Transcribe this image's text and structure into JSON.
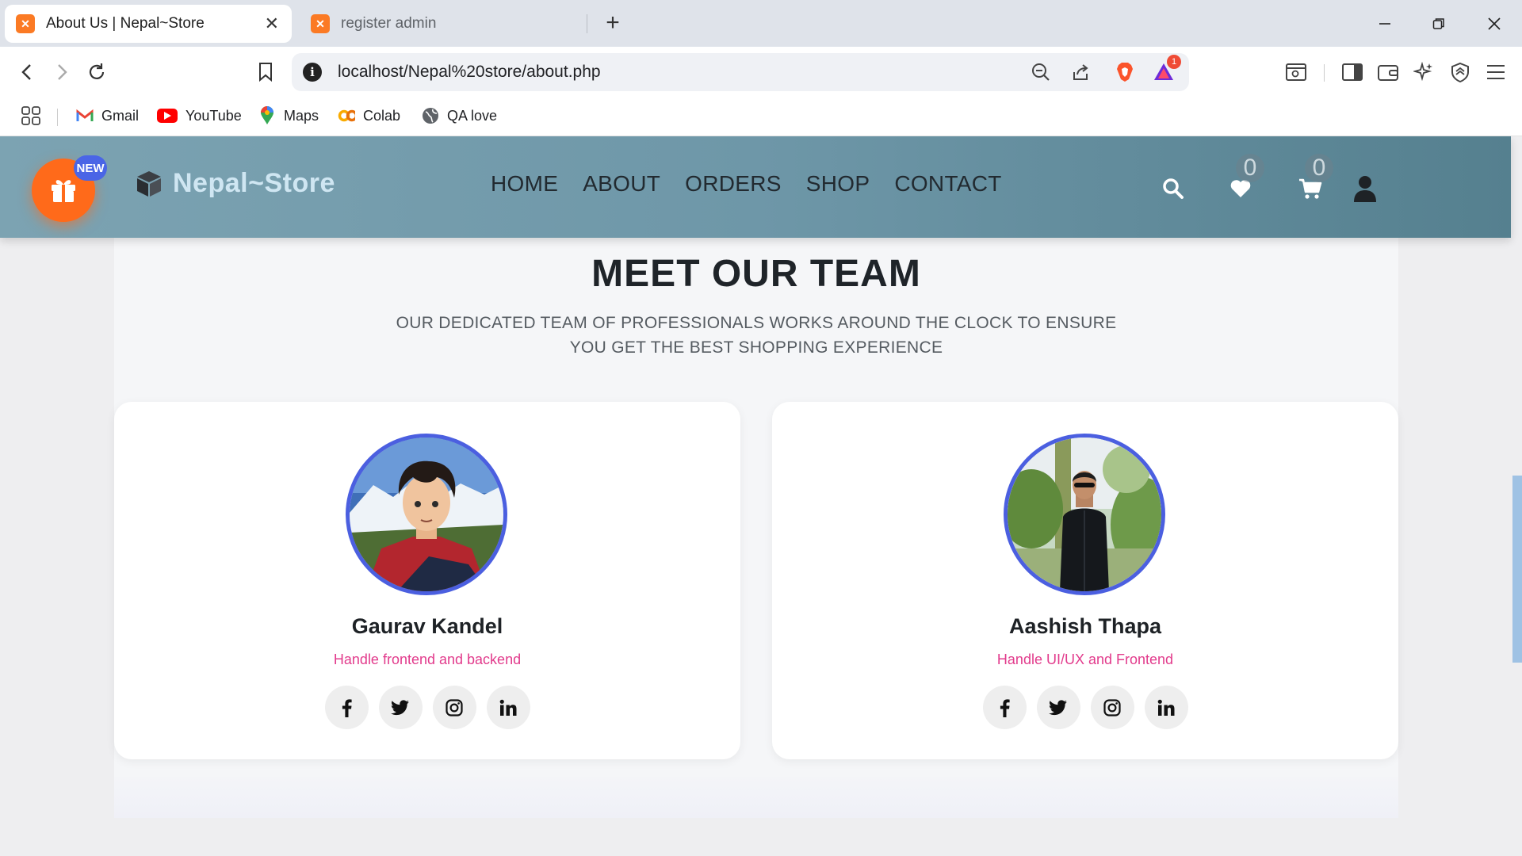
{
  "browser": {
    "tabs": [
      {
        "title": "About Us | Nepal~Store",
        "active": true
      },
      {
        "title": "register admin",
        "active": false
      }
    ],
    "new_tab_label": "+",
    "address": "localhost/Nepal%20store/about.php",
    "notification_count": "1",
    "bookmarks": [
      {
        "label": "Gmail",
        "icon": "gmail-icon"
      },
      {
        "label": "YouTube",
        "icon": "youtube-icon"
      },
      {
        "label": "Maps",
        "icon": "maps-icon"
      },
      {
        "label": "Colab",
        "icon": "colab-icon"
      },
      {
        "label": "QA love",
        "icon": "globe-icon"
      }
    ]
  },
  "site": {
    "brand": "Nepal~Store",
    "new_badge": "NEW",
    "nav": [
      "HOME",
      "ABOUT",
      "ORDERS",
      "SHOP",
      "CONTACT"
    ],
    "wishlist_count": "0",
    "cart_count": "0",
    "colors": {
      "header_start": "#7ca3b2",
      "header_end": "#55808f",
      "gift_button": "#ff6a1a",
      "new_badge": "#4a65e6",
      "avatar_ring": "#4b5fe0",
      "role_text": "#e23b8c"
    }
  },
  "team": {
    "title": "MEET OUR TEAM",
    "subtitle": "OUR DEDICATED TEAM OF PROFESSIONALS WORKS AROUND THE CLOCK TO ENSURE YOU GET THE BEST SHOPPING EXPERIENCE",
    "members": [
      {
        "name": "Gaurav Kandel",
        "role": "Handle frontend and backend",
        "socials": [
          "facebook-icon",
          "twitter-icon",
          "instagram-icon",
          "linkedin-icon"
        ]
      },
      {
        "name": "Aashish Thapa",
        "role": "Handle UI/UX and Frontend",
        "socials": [
          "facebook-icon",
          "twitter-icon",
          "instagram-icon",
          "linkedin-icon"
        ]
      }
    ]
  }
}
